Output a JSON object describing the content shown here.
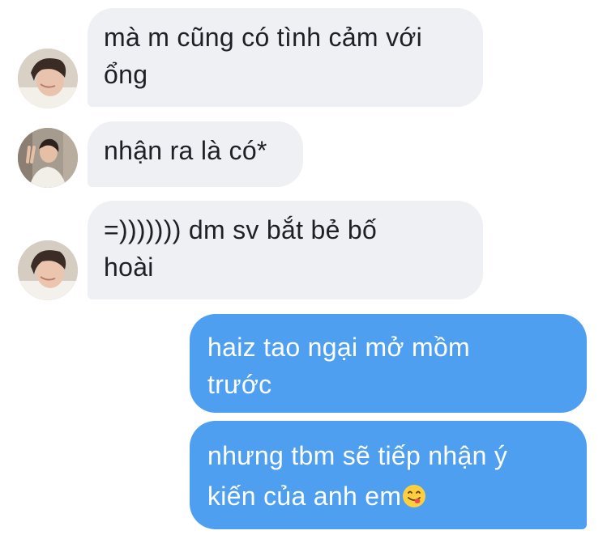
{
  "conversation": {
    "messages": [
      {
        "sender": "contact",
        "text": "mà m cũng có tình cảm với\nổng"
      },
      {
        "sender": "contact",
        "text": "nhận ra là có*"
      },
      {
        "sender": "contact",
        "text": "=))))))) dm sv bắt bẻ bố\nhoài"
      },
      {
        "sender": "me",
        "text": "haiz tao ngại mở mồm\ntrước"
      },
      {
        "sender": "me",
        "text": "nhưng tbm sẽ tiếp nhận ý\nkiến của anh em",
        "emoji": "face-savoring-food-emoji"
      }
    ]
  },
  "colors": {
    "incoming_bubble": "#eef0f3",
    "incoming_text": "#1d2125",
    "outgoing_bubble": "#4e9ff0",
    "outgoing_text": "#ffffff",
    "background": "#ffffff"
  }
}
